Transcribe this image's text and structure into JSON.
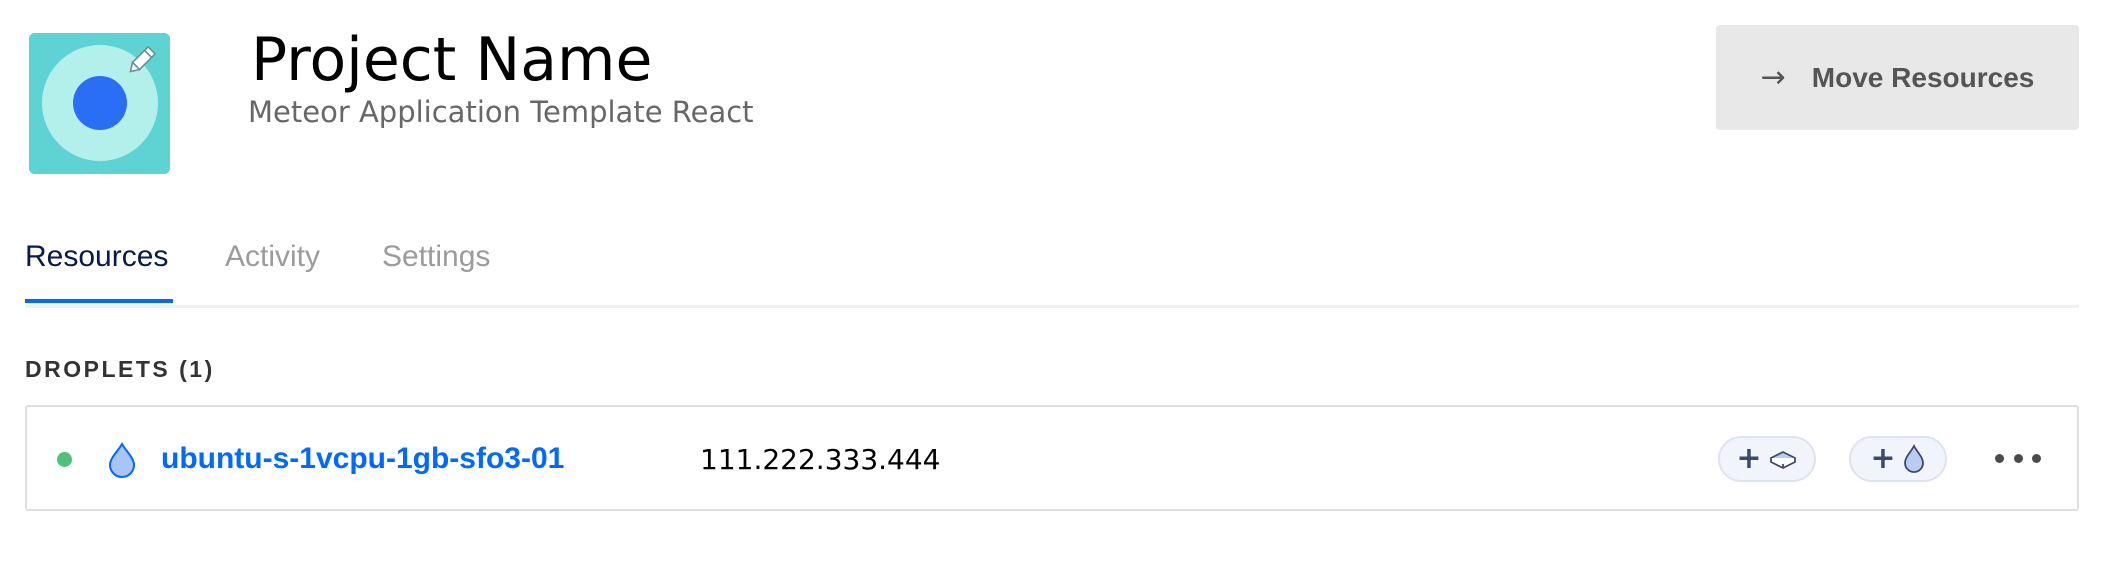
{
  "project": {
    "name": "Project Name",
    "description": "Meteor Application Template React",
    "icon": "project-target-icon",
    "edit_icon": "pencil-icon"
  },
  "header": {
    "move_button_label": "Move Resources",
    "move_button_icon": "arrow-right-icon"
  },
  "tabs": [
    {
      "label": "Resources",
      "active": true
    },
    {
      "label": "Activity",
      "active": false
    },
    {
      "label": "Settings",
      "active": false
    }
  ],
  "droplets_section": {
    "label": "DROPLETS (1)",
    "items": [
      {
        "name": "ubuntu-s-1vcpu-1gb-sfo3-01",
        "ip": "111.222.333.444",
        "status": "active",
        "status_color": "#4fc17b",
        "icon": "droplet-icon",
        "actions": [
          {
            "label": "+",
            "icon": "volume-icon"
          },
          {
            "label": "+",
            "icon": "droplet-icon"
          }
        ],
        "more_icon": "more-horizontal-icon"
      }
    ]
  },
  "colors": {
    "accent": "#0069ff",
    "nav_active": "#031b4e",
    "nav_inactive": "#9b9b9b",
    "icon_bg": "#5dd3d3"
  }
}
